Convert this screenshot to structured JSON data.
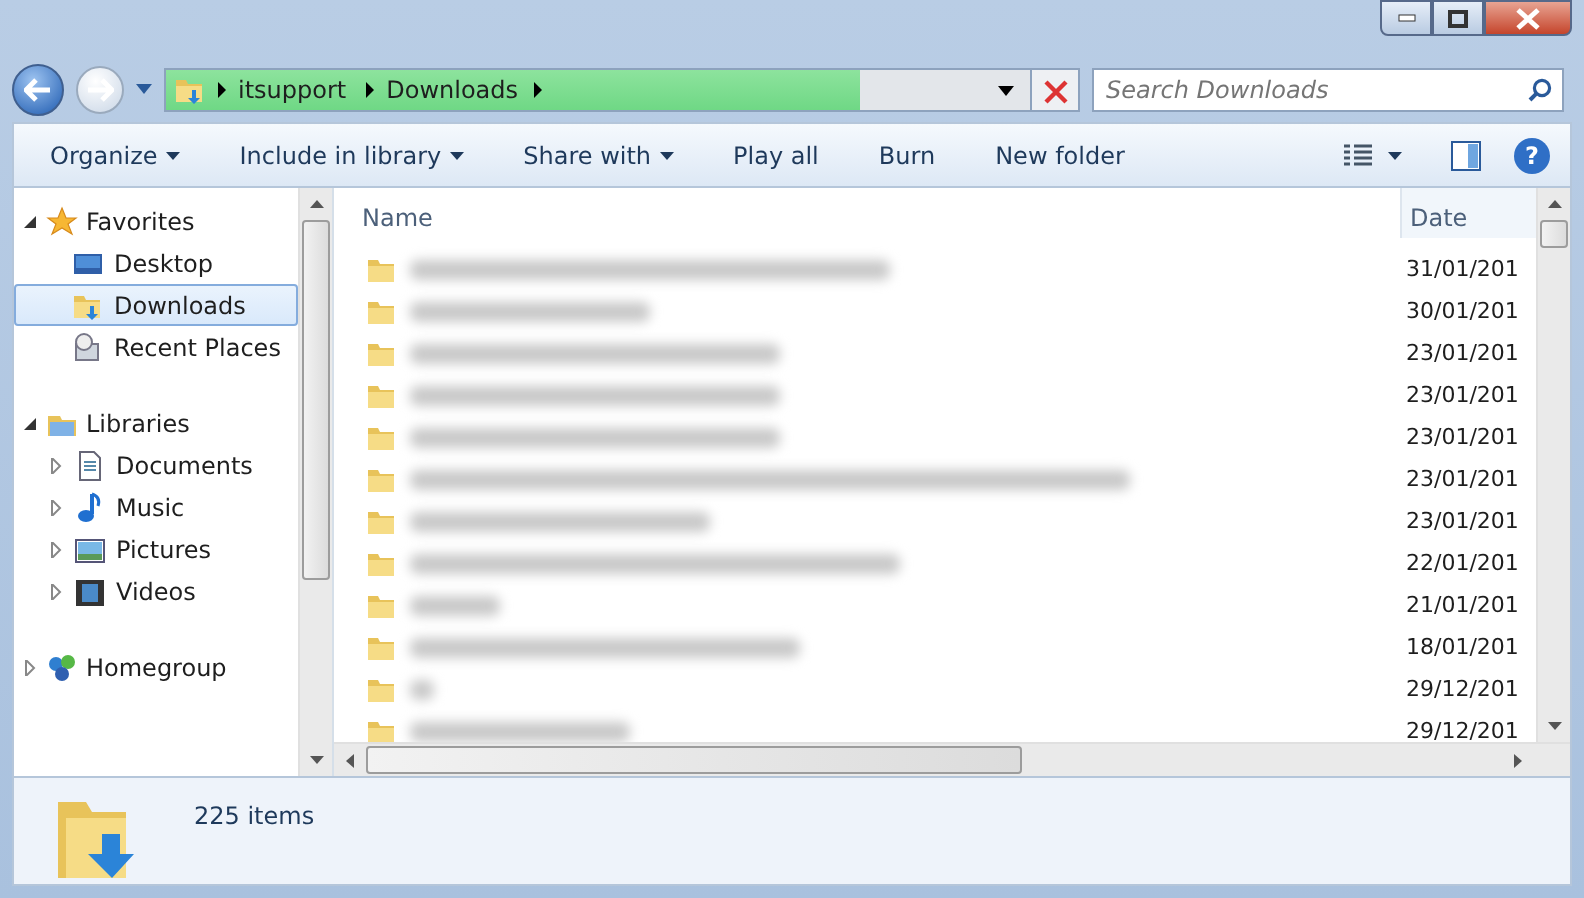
{
  "address_bar": {
    "crumbs": [
      "itsupport",
      "Downloads"
    ],
    "level": 0.76
  },
  "search": {
    "placeholder": "Search Downloads"
  },
  "toolbar": [
    {
      "label": "Organize",
      "dropdown": true
    },
    {
      "label": "Include in library",
      "dropdown": true
    },
    {
      "label": "Share with",
      "dropdown": true
    },
    {
      "label": "Play all",
      "dropdown": false
    },
    {
      "label": "Burn",
      "dropdown": false
    },
    {
      "label": "New folder",
      "dropdown": false
    }
  ],
  "help": {
    "label": "?"
  },
  "sidebar": {
    "groups": [
      {
        "label": "Favorites",
        "kind": "favorites",
        "expanded": true,
        "children": [
          {
            "label": "Desktop",
            "kind": "desktop",
            "selected": false
          },
          {
            "label": "Downloads",
            "kind": "downloads",
            "selected": true
          },
          {
            "label": "Recent Places",
            "kind": "recent",
            "selected": false
          }
        ]
      },
      {
        "label": "Libraries",
        "kind": "libraries",
        "expanded": true,
        "children": [
          {
            "label": "Documents",
            "kind": "documents",
            "selected": false
          },
          {
            "label": "Music",
            "kind": "music",
            "selected": false
          },
          {
            "label": "Pictures",
            "kind": "pictures",
            "selected": false
          },
          {
            "label": "Videos",
            "kind": "videos",
            "selected": false
          }
        ]
      },
      {
        "label": "Homegroup",
        "kind": "homegroup",
        "expanded": false
      }
    ]
  },
  "table": {
    "columns": [
      "Name",
      "Date"
    ],
    "rows": [
      {
        "date": "31/01/201"
      },
      {
        "date": "30/01/201"
      },
      {
        "date": "23/01/201"
      },
      {
        "date": "23/01/201"
      },
      {
        "date": "23/01/201"
      },
      {
        "date": "23/01/201"
      },
      {
        "date": "23/01/201"
      },
      {
        "date": "22/01/201"
      },
      {
        "date": "21/01/201"
      },
      {
        "date": "18/01/201"
      },
      {
        "date": "29/12/201"
      },
      {
        "date": "29/12/201"
      }
    ]
  },
  "status_bar": {
    "count": "225 items"
  }
}
